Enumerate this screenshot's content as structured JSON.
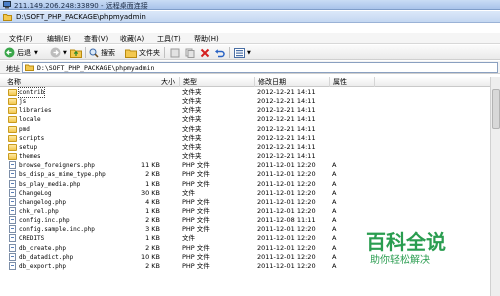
{
  "rdp": {
    "title": "211.149.206.248:33890 - 远程桌面连接"
  },
  "window": {
    "title": "D:\\SOFT_PHP_PACKAGE\\phpmyadmin"
  },
  "menu": [
    "文件(F)",
    "编辑(E)",
    "查看(V)",
    "收藏(A)",
    "工具(T)",
    "帮助(H)"
  ],
  "toolbar": {
    "back": "后退",
    "search": "搜索",
    "folders": "文件夹"
  },
  "address": {
    "label": "地址",
    "value": "D:\\SOFT_PHP_PACKAGE\\phpmyadmin"
  },
  "columns": {
    "name": "名称",
    "size": "大小",
    "type": "类型",
    "modified": "修改日期",
    "attr": "属性"
  },
  "files": [
    {
      "name": "contrib",
      "size": "",
      "type": "文件夹",
      "date": "2012-12-21 14:11",
      "attr": "",
      "kind": "folder"
    },
    {
      "name": "js",
      "size": "",
      "type": "文件夹",
      "date": "2012-12-21 14:11",
      "attr": "",
      "kind": "folder"
    },
    {
      "name": "libraries",
      "size": "",
      "type": "文件夹",
      "date": "2012-12-21 14:11",
      "attr": "",
      "kind": "folder"
    },
    {
      "name": "locale",
      "size": "",
      "type": "文件夹",
      "date": "2012-12-21 14:11",
      "attr": "",
      "kind": "folder"
    },
    {
      "name": "pmd",
      "size": "",
      "type": "文件夹",
      "date": "2012-12-21 14:11",
      "attr": "",
      "kind": "folder"
    },
    {
      "name": "scripts",
      "size": "",
      "type": "文件夹",
      "date": "2012-12-21 14:11",
      "attr": "",
      "kind": "folder"
    },
    {
      "name": "setup",
      "size": "",
      "type": "文件夹",
      "date": "2012-12-21 14:11",
      "attr": "",
      "kind": "folder"
    },
    {
      "name": "themes",
      "size": "",
      "type": "文件夹",
      "date": "2012-12-21 14:11",
      "attr": "",
      "kind": "folder"
    },
    {
      "name": "browse_foreigners.php",
      "size": "11 KB",
      "type": "PHP 文件",
      "date": "2011-12-01 12:20",
      "attr": "A",
      "kind": "file"
    },
    {
      "name": "bs_disp_as_mime_type.php",
      "size": "2 KB",
      "type": "PHP 文件",
      "date": "2011-12-01 12:20",
      "attr": "A",
      "kind": "file"
    },
    {
      "name": "bs_play_media.php",
      "size": "1 KB",
      "type": "PHP 文件",
      "date": "2011-12-01 12:20",
      "attr": "A",
      "kind": "file"
    },
    {
      "name": "ChangeLog",
      "size": "30 KB",
      "type": "文件",
      "date": "2011-12-01 12:20",
      "attr": "A",
      "kind": "file"
    },
    {
      "name": "changelog.php",
      "size": "4 KB",
      "type": "PHP 文件",
      "date": "2011-12-01 12:20",
      "attr": "A",
      "kind": "file"
    },
    {
      "name": "chk_rel.php",
      "size": "1 KB",
      "type": "PHP 文件",
      "date": "2011-12-01 12:20",
      "attr": "A",
      "kind": "file"
    },
    {
      "name": "config.inc.php",
      "size": "2 KB",
      "type": "PHP 文件",
      "date": "2011-12-08 11:11",
      "attr": "A",
      "kind": "file"
    },
    {
      "name": "config.sample.inc.php",
      "size": "3 KB",
      "type": "PHP 文件",
      "date": "2011-12-01 12:20",
      "attr": "A",
      "kind": "file"
    },
    {
      "name": "CREDITS",
      "size": "1 KB",
      "type": "文件",
      "date": "2011-12-01 12:20",
      "attr": "A",
      "kind": "file"
    },
    {
      "name": "db_create.php",
      "size": "2 KB",
      "type": "PHP 文件",
      "date": "2011-12-01 12:20",
      "attr": "A",
      "kind": "file"
    },
    {
      "name": "db_datadict.php",
      "size": "10 KB",
      "type": "PHP 文件",
      "date": "2011-12-01 12:20",
      "attr": "A",
      "kind": "file"
    },
    {
      "name": "db_export.php",
      "size": "2 KB",
      "type": "PHP 文件",
      "date": "2011-12-01 12:20",
      "attr": "A",
      "kind": "file"
    }
  ],
  "watermark": {
    "big": "百科全说",
    "small": "助你轻松解决"
  },
  "colors": {
    "folder": "#f3c84f",
    "accent": "#2a9d50"
  }
}
